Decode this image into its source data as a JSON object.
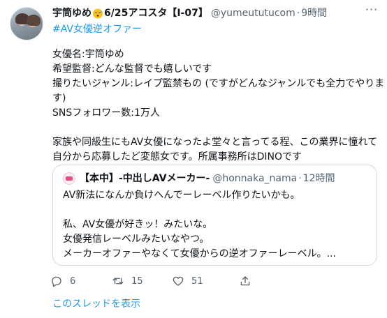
{
  "tweet": {
    "author": {
      "display_name_pre": "宇筒ゆめ",
      "display_name_post": "6/25アコスタ【I-07】",
      "handle": "@yumeututucom",
      "time": "9時間",
      "dot": "·",
      "emoji": "sleepy-face-emoji"
    },
    "more_label": "···",
    "hashtag": "#AV女優逆オファー",
    "body_lines": [
      "女優名:宇筒ゆめ",
      "希望監督:どんな監督でも嬉しいです",
      "撮りたいジャンル:レイプ監禁もの (ですがどんなジャンルでも全力でやりま",
      "す)",
      "SNSフォロワー数:1万人",
      "",
      "家族や同級生にもAV女優になったよ堂々と言ってる程、この業界に憧れて",
      "自分から応募したど変態女です。所属事務所はDINOです"
    ],
    "quote": {
      "display_name": "【本中】-中出しAVメーカー-",
      "handle": "@honnaka_nama",
      "time": "12時間",
      "dot": "·",
      "body_lines": [
        "AV新法になんか負けへんでーレーベル作りたいかも。",
        "",
        "私、AV女優が好きッ！みたいな。",
        "女優発信レーベルみたいなやつ。",
        "メーカーオファーやなくて女優からの逆オファーレーベル。..."
      ]
    },
    "actions": {
      "reply_count": "6",
      "retweet_count": "15",
      "like_count": "51"
    },
    "thread_link": "このスレッドを表示"
  },
  "colors": {
    "link": "#1d9bf0",
    "secondary_text": "#536471",
    "border": "#cfd9de"
  }
}
